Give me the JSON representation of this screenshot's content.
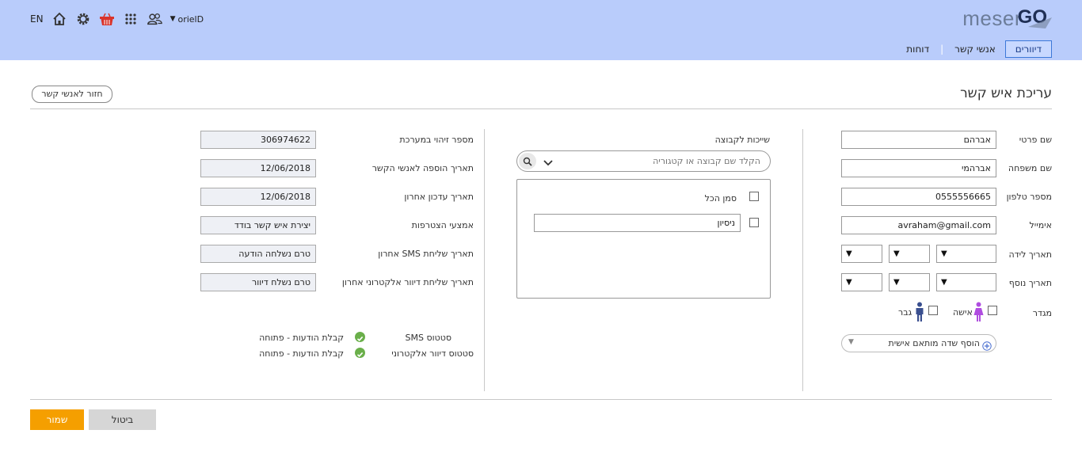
{
  "header": {
    "logo_part1": "meser",
    "logo_part2": "GO",
    "lang": "EN",
    "username": "orielD",
    "nav": [
      "דיוורים",
      "אנשי קשר",
      "דוחות"
    ]
  },
  "page": {
    "title": "עריכת איש קשר",
    "back_button": "חזור לאנשי קשר"
  },
  "personal": {
    "first_name_label": "שם פרטי",
    "first_name": "אברהם",
    "last_name_label": "שם משפחה",
    "last_name": "אברהמי",
    "phone_label": "מספר טלפון",
    "phone": "0555556665",
    "email_label": "אימייל",
    "email": "avraham@gmail.com",
    "birth_label": "תאריך לידה",
    "extra_date_label": "תאריך נוסף",
    "select_arrow": "▼",
    "gender_label": "מגדר",
    "female_label": "אישה",
    "male_label": "גבר",
    "custom_field_label": "הוסף שדה מותאם אישית"
  },
  "groups": {
    "label": "שייכות לקבוצה",
    "search_placeholder": "הקלד שם קבוצה או קטגוריה",
    "select_all": "סמן הכל",
    "items": [
      "ניסיון"
    ]
  },
  "info": {
    "rows": [
      {
        "label": "מספר זיהוי במערכת",
        "value": "306974622"
      },
      {
        "label": "תאריך הוספה לאנשי הקשר",
        "value": "12/06/2018"
      },
      {
        "label": "תאריך עדכון אחרון",
        "value": "12/06/2018"
      },
      {
        "label": "אמצעי הצטרפות",
        "value": "יצירת איש קשר בודד"
      },
      {
        "label": "תאריך שליחת SMS אחרון",
        "value": "טרם נשלחה הודעה"
      },
      {
        "label": "תאריך שליחת דיוור אלקטרוני אחרון",
        "value": "טרם נשלח דיוור"
      }
    ],
    "sms_status_label": "סטטוס SMS",
    "sms_status_value": "קבלת הודעות - פתוחה",
    "email_status_label": "סטטוס דיוור אלקטרוני",
    "email_status_value": "קבלת הודעות - פתוחה"
  },
  "actions": {
    "save": "שמור",
    "cancel": "ביטול"
  },
  "colors": {
    "header_bg": "#b9ccfb",
    "save_button": "#f59f00",
    "status_ok": "#6aaf4a",
    "female_icon": "#b04de0",
    "male_icon": "#3a4f8f",
    "basket_icon": "#d9342b"
  }
}
